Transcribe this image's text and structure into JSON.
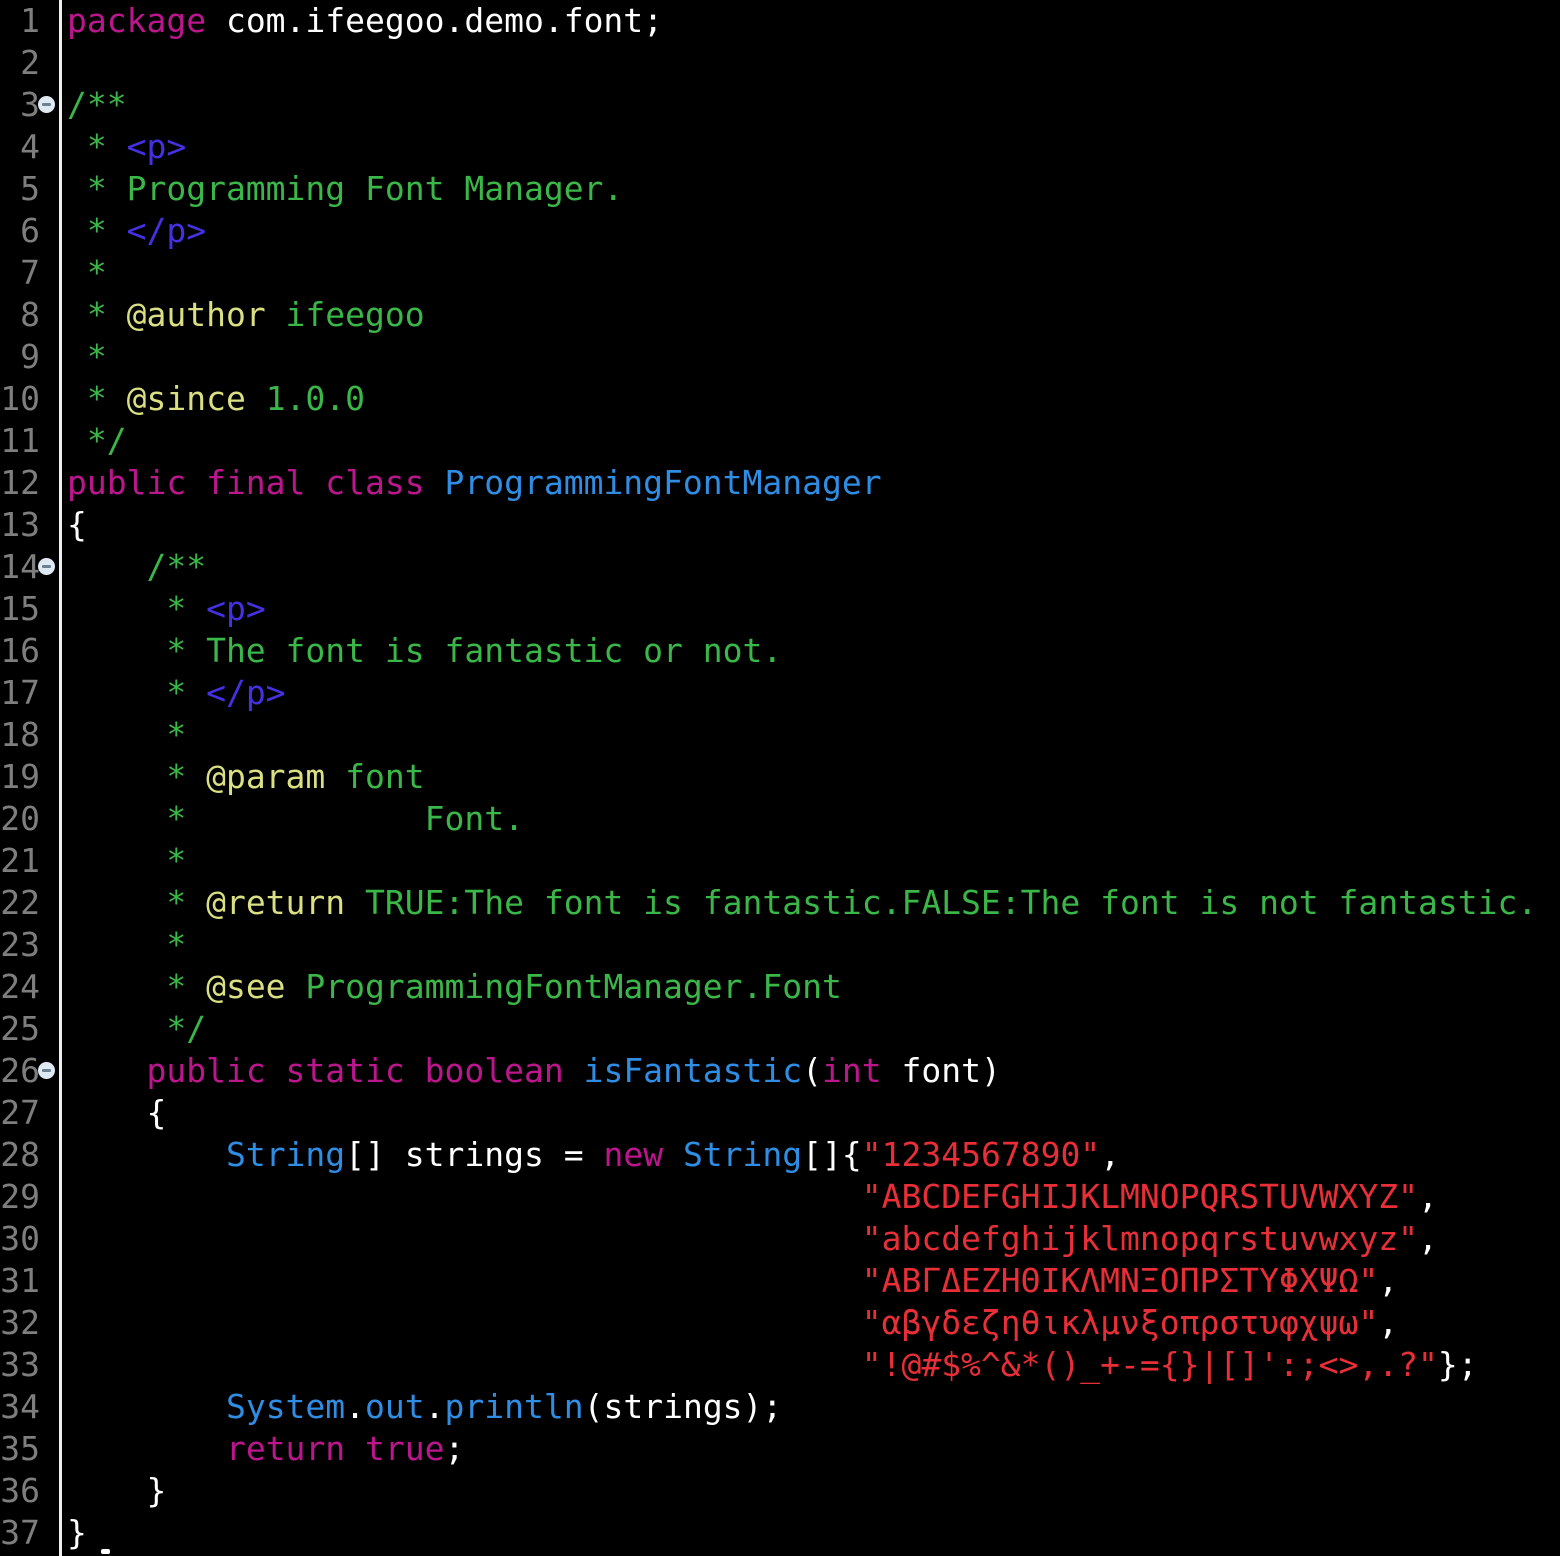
{
  "editor": {
    "language_hint": "java-source-code",
    "background": "#000000",
    "colors": {
      "plain": "#ffffff",
      "keyword": "#bc168d",
      "type": "#2f8de4",
      "comment": "#3bb648",
      "doctag": "#dadf82",
      "htmltag": "#4431e2",
      "string": "#e82f38",
      "linenum": "#7e7e7e",
      "separator": "#efefef",
      "fold_circle": "#dde9f3",
      "fold_bar": "#6f8090",
      "cursor": "#ffffff"
    },
    "fold_lines": [
      3,
      14,
      26
    ],
    "lines": [
      {
        "n": 1,
        "tokens": [
          [
            "keyword",
            "package"
          ],
          [
            "plain",
            " com.ifeegoo.demo.font;"
          ]
        ]
      },
      {
        "n": 2,
        "tokens": []
      },
      {
        "n": 3,
        "tokens": [
          [
            "comment",
            "/**"
          ]
        ]
      },
      {
        "n": 4,
        "tokens": [
          [
            "comment",
            " * "
          ],
          [
            "htmltag",
            "<p>"
          ]
        ]
      },
      {
        "n": 5,
        "tokens": [
          [
            "comment",
            " * Programming Font Manager."
          ]
        ]
      },
      {
        "n": 6,
        "tokens": [
          [
            "comment",
            " * "
          ],
          [
            "htmltag",
            "</p>"
          ]
        ]
      },
      {
        "n": 7,
        "tokens": [
          [
            "comment",
            " *"
          ]
        ]
      },
      {
        "n": 8,
        "tokens": [
          [
            "comment",
            " * "
          ],
          [
            "doctag",
            "@author"
          ],
          [
            "comment",
            " ifeegoo"
          ]
        ]
      },
      {
        "n": 9,
        "tokens": [
          [
            "comment",
            " *"
          ]
        ]
      },
      {
        "n": 10,
        "tokens": [
          [
            "comment",
            " * "
          ],
          [
            "doctag",
            "@since"
          ],
          [
            "comment",
            " 1.0.0"
          ]
        ]
      },
      {
        "n": 11,
        "tokens": [
          [
            "comment",
            " */"
          ]
        ]
      },
      {
        "n": 12,
        "tokens": [
          [
            "keyword",
            "public final class "
          ],
          [
            "type",
            "ProgrammingFontManager"
          ]
        ]
      },
      {
        "n": 13,
        "tokens": [
          [
            "plain",
            "{"
          ]
        ]
      },
      {
        "n": 14,
        "tokens": [
          [
            "comment",
            "    /**"
          ]
        ]
      },
      {
        "n": 15,
        "tokens": [
          [
            "comment",
            "     * "
          ],
          [
            "htmltag",
            "<p>"
          ]
        ]
      },
      {
        "n": 16,
        "tokens": [
          [
            "comment",
            "     * The font is fantastic or not."
          ]
        ]
      },
      {
        "n": 17,
        "tokens": [
          [
            "comment",
            "     * "
          ],
          [
            "htmltag",
            "</p>"
          ]
        ]
      },
      {
        "n": 18,
        "tokens": [
          [
            "comment",
            "     *"
          ]
        ]
      },
      {
        "n": 19,
        "tokens": [
          [
            "comment",
            "     * "
          ],
          [
            "doctag",
            "@param"
          ],
          [
            "comment",
            " font"
          ]
        ]
      },
      {
        "n": 20,
        "tokens": [
          [
            "comment",
            "     *            Font."
          ]
        ]
      },
      {
        "n": 21,
        "tokens": [
          [
            "comment",
            "     *"
          ]
        ]
      },
      {
        "n": 22,
        "tokens": [
          [
            "comment",
            "     * "
          ],
          [
            "doctag",
            "@return"
          ],
          [
            "comment",
            " TRUE:The font is fantastic.FALSE:The font is not fantastic."
          ]
        ]
      },
      {
        "n": 23,
        "tokens": [
          [
            "comment",
            "     *"
          ]
        ]
      },
      {
        "n": 24,
        "tokens": [
          [
            "comment",
            "     * "
          ],
          [
            "doctag",
            "@see"
          ],
          [
            "comment",
            " ProgrammingFontManager.Font"
          ]
        ]
      },
      {
        "n": 25,
        "tokens": [
          [
            "comment",
            "     */"
          ]
        ]
      },
      {
        "n": 26,
        "tokens": [
          [
            "plain",
            "    "
          ],
          [
            "keyword",
            "public static boolean "
          ],
          [
            "type",
            "isFantastic"
          ],
          [
            "plain",
            "("
          ],
          [
            "keyword",
            "int"
          ],
          [
            "plain",
            " font)"
          ]
        ]
      },
      {
        "n": 27,
        "tokens": [
          [
            "plain",
            "    {"
          ]
        ]
      },
      {
        "n": 28,
        "tokens": [
          [
            "plain",
            "        "
          ],
          [
            "type",
            "String"
          ],
          [
            "plain",
            "[] strings = "
          ],
          [
            "keyword",
            "new"
          ],
          [
            "plain",
            " "
          ],
          [
            "type",
            "String"
          ],
          [
            "plain",
            "[]{"
          ],
          [
            "string",
            "\"1234567890\""
          ],
          [
            "plain",
            ","
          ]
        ]
      },
      {
        "n": 29,
        "tokens": [
          [
            "plain",
            "                                        "
          ],
          [
            "string",
            "\"ABCDEFGHIJKLMNOPQRSTUVWXYZ\""
          ],
          [
            "plain",
            ","
          ]
        ]
      },
      {
        "n": 30,
        "tokens": [
          [
            "plain",
            "                                        "
          ],
          [
            "string",
            "\"abcdefghijklmnopqrstuvwxyz\""
          ],
          [
            "plain",
            ","
          ]
        ]
      },
      {
        "n": 31,
        "tokens": [
          [
            "plain",
            "                                        "
          ],
          [
            "string",
            "\"ΑΒΓΔΕΖΗΘΙΚΛΜΝΞΟΠΡΣΤΥΦΧΨΩ\""
          ],
          [
            "plain",
            ","
          ]
        ]
      },
      {
        "n": 32,
        "tokens": [
          [
            "plain",
            "                                        "
          ],
          [
            "string",
            "\"αβγδεζηθικλμνξοπρστυφχψω\""
          ],
          [
            "plain",
            ","
          ]
        ]
      },
      {
        "n": 33,
        "tokens": [
          [
            "plain",
            "                                        "
          ],
          [
            "string",
            "\"!@#$%^&*()_+-={}|[]':;<>,.?\""
          ],
          [
            "plain",
            "};"
          ]
        ]
      },
      {
        "n": 34,
        "tokens": [
          [
            "plain",
            "        "
          ],
          [
            "type",
            "System"
          ],
          [
            "plain",
            "."
          ],
          [
            "type",
            "out"
          ],
          [
            "plain",
            "."
          ],
          [
            "type",
            "println"
          ],
          [
            "plain",
            "(strings);"
          ]
        ]
      },
      {
        "n": 35,
        "tokens": [
          [
            "plain",
            "        "
          ],
          [
            "keyword",
            "return true"
          ],
          [
            "plain",
            ";"
          ]
        ]
      },
      {
        "n": 36,
        "tokens": [
          [
            "plain",
            "    }"
          ]
        ]
      },
      {
        "n": 37,
        "tokens": [
          [
            "plain",
            "}"
          ]
        ]
      }
    ]
  }
}
